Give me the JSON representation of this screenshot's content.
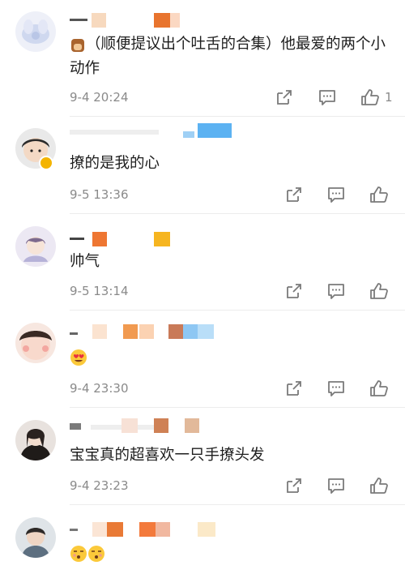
{
  "comments": [
    {
      "text": "（顺便提议出个吐舌的合集）他最爱的两个小动作",
      "time": "9-4 20:24",
      "like_count": "1"
    },
    {
      "text": "撩的是我的心",
      "time": "9-5 13:36",
      "like_count": ""
    },
    {
      "text": "帅气",
      "time": "9-5 13:14",
      "like_count": ""
    },
    {
      "text": "😍",
      "time": "9-4 23:30",
      "like_count": ""
    },
    {
      "text": "宝宝真的超喜欢一只手撩头发",
      "time": "9-4 23:23",
      "like_count": ""
    },
    {
      "text": "😚😚",
      "time": "",
      "like_count": ""
    }
  ],
  "icons": {
    "share": "share-icon",
    "reply": "comment-icon",
    "like": "thumbs-up-icon",
    "verified": "verified-badge-icon"
  },
  "colors": {
    "meta_text": "#8a8a8a",
    "icon": "#7a7a7a",
    "divider": "#ececec",
    "badge": "#f4b400"
  }
}
